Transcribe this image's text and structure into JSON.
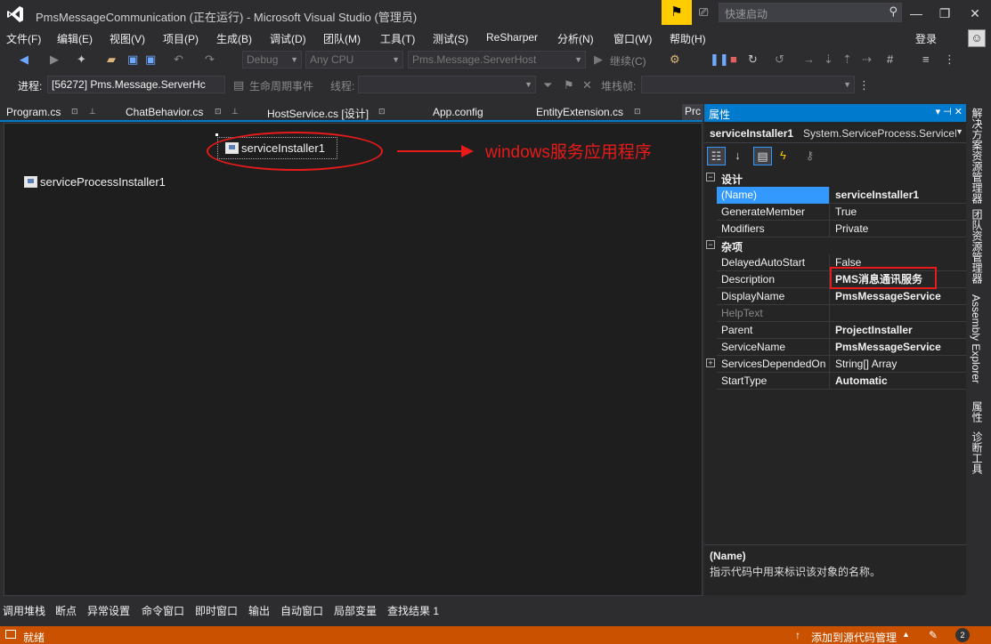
{
  "window": {
    "title": "PmsMessageCommunication (正在运行) - Microsoft Visual Studio (管理员)",
    "quick_launch_placeholder": "快速启动",
    "minimize": "—",
    "restore": "❐",
    "close": "✕"
  },
  "menu": [
    "文件(F)",
    "编辑(E)",
    "视图(V)",
    "项目(P)",
    "生成(B)",
    "调试(D)",
    "团队(M)",
    "工具(T)",
    "测试(S)",
    "ReSharper",
    "分析(N)",
    "窗口(W)",
    "帮助(H)"
  ],
  "login": "登录",
  "toolbar1": {
    "config": "Debug",
    "platform": "Any CPU",
    "startup_project": "Pms.Message.ServerHost",
    "continue_label": "继续(C)"
  },
  "toolbar2": {
    "process_label": "进程:",
    "process_value": "[56272] Pms.Message.ServerHc",
    "lifecycle_label": "生命周期事件",
    "thread_label": "线程:",
    "stackframe_label": "堆栈帧:"
  },
  "tabs": [
    {
      "label": "Program.cs"
    },
    {
      "label": "ChatBehavior.cs"
    },
    {
      "label": "HostService.cs [设计]"
    },
    {
      "label": "App.config"
    },
    {
      "label": "EntityExtension.cs"
    },
    {
      "label": "Prc"
    }
  ],
  "designer": {
    "component1": "serviceInstaller1",
    "component2": "serviceProcessInstaller1",
    "annotation": "windows服务应用程序"
  },
  "properties": {
    "title": "属性",
    "object_name": "serviceInstaller1",
    "object_type": "System.ServiceProcess.ServiceInsta",
    "cat_design": "设计",
    "cat_misc": "杂项",
    "rows_design": [
      {
        "name": "(Name)",
        "value": "serviceInstaller1"
      },
      {
        "name": "GenerateMember",
        "value": "True"
      },
      {
        "name": "Modifiers",
        "value": "Private"
      }
    ],
    "rows_misc": [
      {
        "name": "DelayedAutoStart",
        "value": "False"
      },
      {
        "name": "Description",
        "value": "PMS消息通讯服务"
      },
      {
        "name": "DisplayName",
        "value": "PmsMessageService"
      },
      {
        "name": "HelpText",
        "value": ""
      },
      {
        "name": "Parent",
        "value": "ProjectInstaller"
      },
      {
        "name": "ServiceName",
        "value": "PmsMessageService"
      },
      {
        "name": "ServicesDependedOn",
        "value": "String[] Array"
      },
      {
        "name": "StartType",
        "value": "Automatic"
      }
    ],
    "desc_name": "(Name)",
    "desc_text": "指示代码中用来标识该对象的名称。"
  },
  "side_tabs": [
    "解决方案资源管理器",
    "团队资源管理器",
    "Assembly Explorer",
    "属性",
    "诊断工具"
  ],
  "bottom_tabs": [
    "调用堆栈",
    "断点",
    "异常设置",
    "命令窗口",
    "即时窗口",
    "输出",
    "自动窗口",
    "局部变量",
    "查找结果 1"
  ],
  "status": {
    "text": "就绪",
    "source_control": "添加到源代码管理",
    "notification_count": "2"
  },
  "colors": {
    "accent": "#007acc",
    "status_bar": "#ca5100",
    "annotation": "#e81a1a",
    "flag": "#ffcc00"
  }
}
